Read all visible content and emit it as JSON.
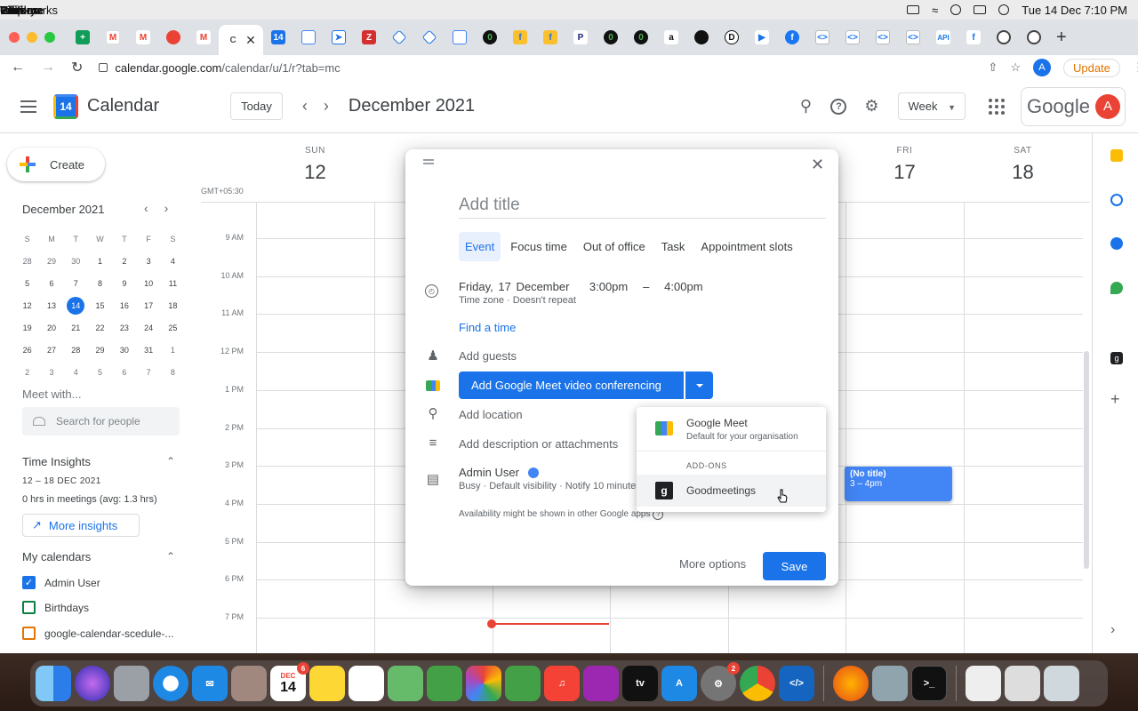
{
  "mac_menubar": {
    "app": "Chrome",
    "menus": [
      "File",
      "Edit",
      "View",
      "History",
      "Bookmarks",
      "Profiles",
      "Tab",
      "Window",
      "Help"
    ],
    "clock": "Tue 14 Dec  7:10 PM"
  },
  "browser": {
    "url_host": "calendar.google.com",
    "url_path": "/calendar/u/1/r?tab=mc",
    "profile_initial": "A",
    "update_label": "Update"
  },
  "header": {
    "app_name": "Calendar",
    "logo_day": "14",
    "today_label": "Today",
    "month_title": "December 2021",
    "view_label": "Week",
    "google_word": "Google",
    "avatar_initial": "A"
  },
  "sidebar": {
    "create_label": "Create",
    "mini_cal_title": "December 2021",
    "mini_dow": [
      "S",
      "M",
      "T",
      "W",
      "T",
      "F",
      "S"
    ],
    "mini_weeks": [
      [
        "28",
        "29",
        "30",
        "1",
        "2",
        "3",
        "4"
      ],
      [
        "5",
        "6",
        "7",
        "8",
        "9",
        "10",
        "11"
      ],
      [
        "12",
        "13",
        "14",
        "15",
        "16",
        "17",
        "18"
      ],
      [
        "19",
        "20",
        "21",
        "22",
        "23",
        "24",
        "25"
      ],
      [
        "26",
        "27",
        "28",
        "29",
        "30",
        "31",
        "1"
      ],
      [
        "2",
        "3",
        "4",
        "5",
        "6",
        "7",
        "8"
      ]
    ],
    "meet_with": "Meet with...",
    "search_people_placeholder": "Search for people",
    "time_insights": "Time Insights",
    "ti_range": "12 – 18 DEC 2021",
    "ti_stats": "0 hrs in meetings (avg: 1.3 hrs)",
    "more_insights": "More insights",
    "my_calendars": "My calendars",
    "calendars": [
      {
        "name": "Admin User",
        "color": "#1a73e8",
        "checked": true
      },
      {
        "name": "Birthdays",
        "color": "#0b8043",
        "checked": false
      },
      {
        "name": "google-calendar-scedule-...",
        "color": "#e37400",
        "checked": false
      }
    ]
  },
  "week": {
    "days": [
      {
        "dow": "SUN",
        "num": "12"
      },
      {
        "dow": "FRI",
        "num": "17"
      },
      {
        "dow": "SAT",
        "num": "18"
      }
    ],
    "gmt": "GMT+05:30",
    "hours": [
      "9 AM",
      "10 AM",
      "11 AM",
      "12 PM",
      "1 PM",
      "2 PM",
      "3 PM",
      "4 PM",
      "5 PM",
      "6 PM",
      "7 PM"
    ],
    "event": {
      "title": "(No title)",
      "time": "3 – 4pm",
      "color": "#4285f4"
    }
  },
  "dialog": {
    "title_placeholder": "Add title",
    "tabs": [
      "Event",
      "Focus time",
      "Out of office",
      "Task",
      "Appointment slots"
    ],
    "date": "Friday, 17 December",
    "time_start": "3:00pm",
    "time_sep": "–",
    "time_end": "4:00pm",
    "time_sub": "Time zone · Doesn't repeat",
    "find_time": "Find a time",
    "add_guests": "Add guests",
    "meet_button": "Add Google Meet video conferencing",
    "add_location": "Add location",
    "add_description": "Add description or attachments",
    "owner": "Admin User",
    "owner_sub": "Busy · Default visibility · Notify 10 minutes before",
    "availability_note": "Availability might be shown in other Google apps",
    "more_options": "More options",
    "save": "Save"
  },
  "conf_menu": {
    "meet_title": "Google Meet",
    "meet_sub": "Default for your organisation",
    "addons_label": "ADD-ONS",
    "addon_name": "Goodmeetings",
    "addon_logo": "g"
  },
  "dock": {
    "calendar_month": "DEC",
    "calendar_day": "14",
    "calendar_badge": "6",
    "settings_badge": "2"
  }
}
